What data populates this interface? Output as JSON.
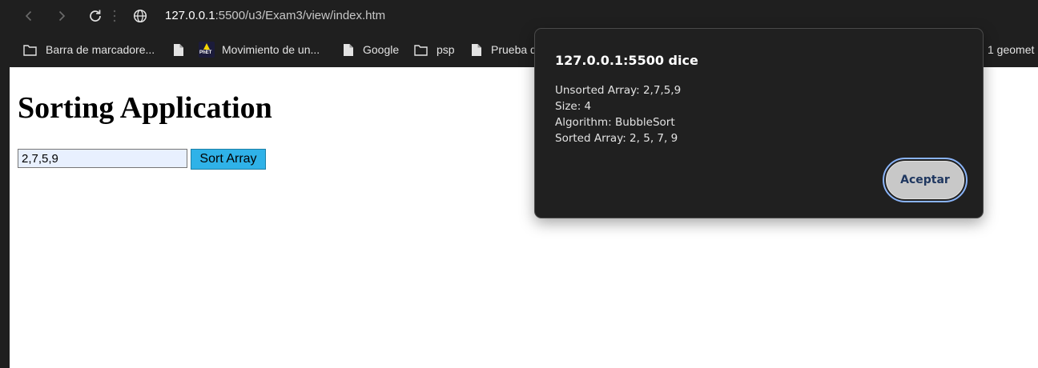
{
  "browser": {
    "url_host": "127.0.0.1",
    "url_path": ":5500/u3/Exam3/view/index.htm",
    "bookmarks": [
      {
        "label": "Barra de marcadore...",
        "icon": "folder-icon"
      },
      {
        "label": "Movimiento de un...",
        "icon": "phet-icon"
      },
      {
        "label": "Google",
        "icon": "page-icon"
      },
      {
        "label": "psp",
        "icon": "folder-icon"
      },
      {
        "label": "Prueba d",
        "icon": "page-icon"
      },
      {
        "label": "1 geomet",
        "icon": "none"
      }
    ]
  },
  "page": {
    "title": "Sorting Application",
    "input_value": "2,7,5,9",
    "sort_button_label": "Sort Array"
  },
  "dialog": {
    "title": "127.0.0.1:5500 dice",
    "lines": [
      "Unsorted Array: 2,7,5,9",
      "Size: 4",
      "Algorithm: BubbleSort",
      "Sorted Array: 2, 5, 7, 9"
    ],
    "accept_label": "Aceptar"
  },
  "colors": {
    "chrome_background": "#1f1f1f",
    "dialog_background": "#202020",
    "sort_button": "#2fb2e8",
    "input_autofill": "#e8f0fe",
    "focus_ring": "#8ab4f8"
  }
}
